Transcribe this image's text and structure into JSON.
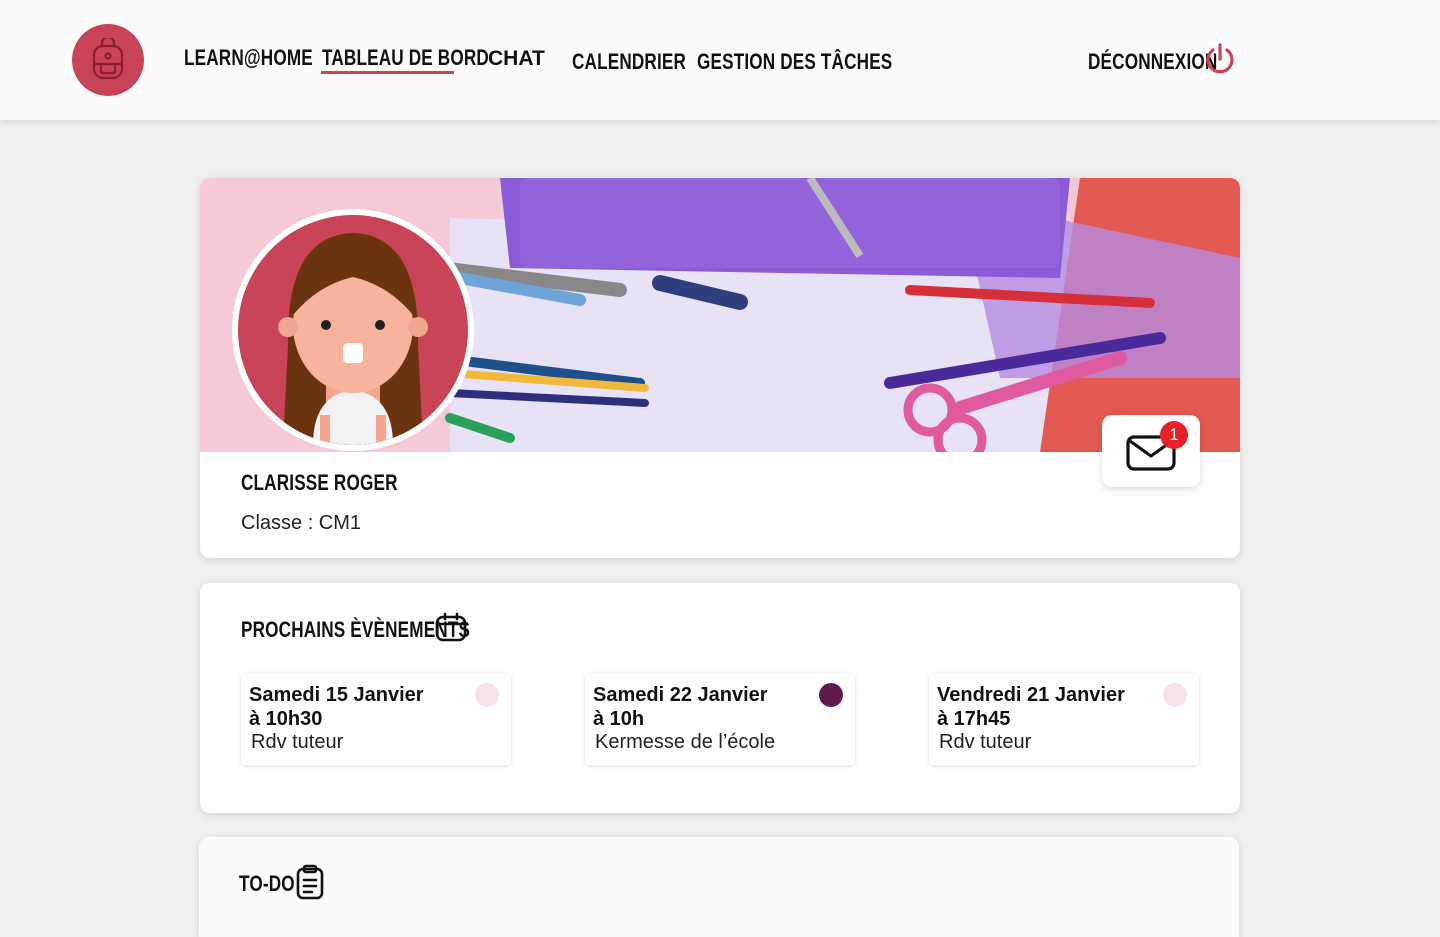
{
  "header": {
    "nav": [
      {
        "label": "LEARN@HOME",
        "active": false
      },
      {
        "label": "TABLEAU DE BORD",
        "active": true
      },
      {
        "label": "CHAT",
        "active": false
      },
      {
        "label": "CALENDRIER",
        "active": false
      },
      {
        "label": "GESTION DES TÂCHES",
        "active": false
      }
    ],
    "logout_label": "DÉCONNEXION",
    "logo_icon": "backpack-icon",
    "logout_icon": "power-icon"
  },
  "profile": {
    "name": "CLARISSE ROGER",
    "class_label": "Classe : CM1",
    "messages_badge": "1",
    "messages_icon": "envelope-icon"
  },
  "events": {
    "title": "PROCHAINS ÈVÈNEMENTS",
    "title_icon": "calendar-icon",
    "items": [
      {
        "date_line1": "Samedi 15 Janvier",
        "date_line2": "à 10h30",
        "description": "Rdv tuteur",
        "dot_color": "#f6e2e6"
      },
      {
        "date_line1": "Samedi 22 Janvier",
        "date_line2": "à 10h",
        "description": "Kermesse de l’école",
        "dot_color": "#5c1a4b"
      },
      {
        "date_line1": "Vendredi 21 Janvier",
        "date_line2": "à 17h45",
        "description": "Rdv tuteur",
        "dot_color": "#f6e2e6"
      }
    ]
  },
  "todo": {
    "title": "TO-DO",
    "title_icon": "clipboard-icon"
  },
  "colors": {
    "accent": "#c94456",
    "background": "#f0f0f0"
  }
}
